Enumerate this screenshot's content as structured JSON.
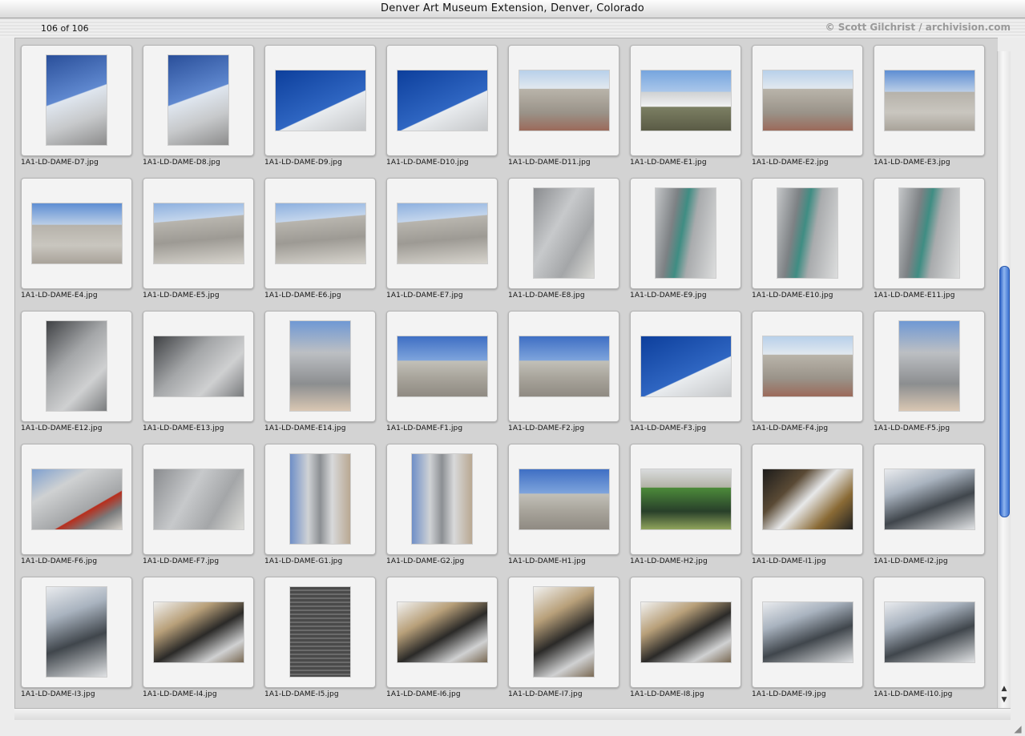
{
  "window": {
    "title": "Denver Art Museum Extension, Denver, Colorado"
  },
  "header": {
    "count": "106 of 106",
    "credit": "© Scott Gilchrist / archivision.com"
  },
  "icons": {
    "scroll_up": "▲",
    "scroll_down": "▼",
    "resize": "◢"
  },
  "thumbnails": [
    {
      "name": "1A1-LD-DAME-D7.jpg",
      "orientation": "portrait",
      "scene": "s-sky"
    },
    {
      "name": "1A1-LD-DAME-D8.jpg",
      "orientation": "portrait",
      "scene": "s-sky"
    },
    {
      "name": "1A1-LD-DAME-D9.jpg",
      "orientation": "landscape",
      "scene": "s-blue"
    },
    {
      "name": "1A1-LD-DAME-D10.jpg",
      "orientation": "landscape",
      "scene": "s-blue"
    },
    {
      "name": "1A1-LD-DAME-D11.jpg",
      "orientation": "landscape",
      "scene": "s-facade"
    },
    {
      "name": "1A1-LD-DAME-E1.jpg",
      "orientation": "landscape",
      "scene": "s-wide"
    },
    {
      "name": "1A1-LD-DAME-E2.jpg",
      "orientation": "landscape",
      "scene": "s-facade"
    },
    {
      "name": "1A1-LD-DAME-E3.jpg",
      "orientation": "landscape",
      "scene": "s-roof"
    },
    {
      "name": "1A1-LD-DAME-E4.jpg",
      "orientation": "landscape",
      "scene": "s-roof"
    },
    {
      "name": "1A1-LD-DAME-E5.jpg",
      "orientation": "landscape",
      "scene": "s-terrace"
    },
    {
      "name": "1A1-LD-DAME-E6.jpg",
      "orientation": "landscape",
      "scene": "s-terrace"
    },
    {
      "name": "1A1-LD-DAME-E7.jpg",
      "orientation": "landscape",
      "scene": "s-terrace"
    },
    {
      "name": "1A1-LD-DAME-E8.jpg",
      "orientation": "portrait",
      "scene": "s-wall"
    },
    {
      "name": "1A1-LD-DAME-E9.jpg",
      "orientation": "portrait",
      "scene": "s-glass"
    },
    {
      "name": "1A1-LD-DAME-E10.jpg",
      "orientation": "portrait",
      "scene": "s-glass"
    },
    {
      "name": "1A1-LD-DAME-E11.jpg",
      "orientation": "portrait",
      "scene": "s-glass"
    },
    {
      "name": "1A1-LD-DAME-E12.jpg",
      "orientation": "portrait",
      "scene": "s-cave"
    },
    {
      "name": "1A1-LD-DAME-E13.jpg",
      "orientation": "landscape",
      "scene": "s-cave"
    },
    {
      "name": "1A1-LD-DAME-E14.jpg",
      "orientation": "portrait",
      "scene": "s-tall"
    },
    {
      "name": "1A1-LD-DAME-F1.jpg",
      "orientation": "landscape",
      "scene": "s-street"
    },
    {
      "name": "1A1-LD-DAME-F2.jpg",
      "orientation": "landscape",
      "scene": "s-street"
    },
    {
      "name": "1A1-LD-DAME-F3.jpg",
      "orientation": "landscape",
      "scene": "s-blue"
    },
    {
      "name": "1A1-LD-DAME-F4.jpg",
      "orientation": "landscape",
      "scene": "s-facade"
    },
    {
      "name": "1A1-LD-DAME-F5.jpg",
      "orientation": "portrait",
      "scene": "s-tall"
    },
    {
      "name": "1A1-LD-DAME-F6.jpg",
      "orientation": "landscape",
      "scene": "s-red"
    },
    {
      "name": "1A1-LD-DAME-F7.jpg",
      "orientation": "landscape",
      "scene": "s-wall"
    },
    {
      "name": "1A1-LD-DAME-G1.jpg",
      "orientation": "portrait",
      "scene": "s-sign"
    },
    {
      "name": "1A1-LD-DAME-G2.jpg",
      "orientation": "portrait",
      "scene": "s-sign"
    },
    {
      "name": "1A1-LD-DAME-H1.jpg",
      "orientation": "landscape",
      "scene": "s-street"
    },
    {
      "name": "1A1-LD-DAME-H2.jpg",
      "orientation": "landscape",
      "scene": "s-park"
    },
    {
      "name": "1A1-LD-DAME-I1.jpg",
      "orientation": "landscape",
      "scene": "s-atrium"
    },
    {
      "name": "1A1-LD-DAME-I2.jpg",
      "orientation": "landscape",
      "scene": "s-interior"
    },
    {
      "name": "1A1-LD-DAME-I3.jpg",
      "orientation": "portrait",
      "scene": "s-interior"
    },
    {
      "name": "1A1-LD-DAME-I4.jpg",
      "orientation": "landscape",
      "scene": "s-warm"
    },
    {
      "name": "1A1-LD-DAME-I5.jpg",
      "orientation": "portrait",
      "scene": "s-stairs"
    },
    {
      "name": "1A1-LD-DAME-I6.jpg",
      "orientation": "landscape",
      "scene": "s-warm"
    },
    {
      "name": "1A1-LD-DAME-I7.jpg",
      "orientation": "portrait",
      "scene": "s-warm"
    },
    {
      "name": "1A1-LD-DAME-I8.jpg",
      "orientation": "landscape",
      "scene": "s-warm"
    },
    {
      "name": "1A1-LD-DAME-I9.jpg",
      "orientation": "landscape",
      "scene": "s-interior"
    },
    {
      "name": "1A1-LD-DAME-I10.jpg",
      "orientation": "landscape",
      "scene": "s-interior"
    }
  ]
}
